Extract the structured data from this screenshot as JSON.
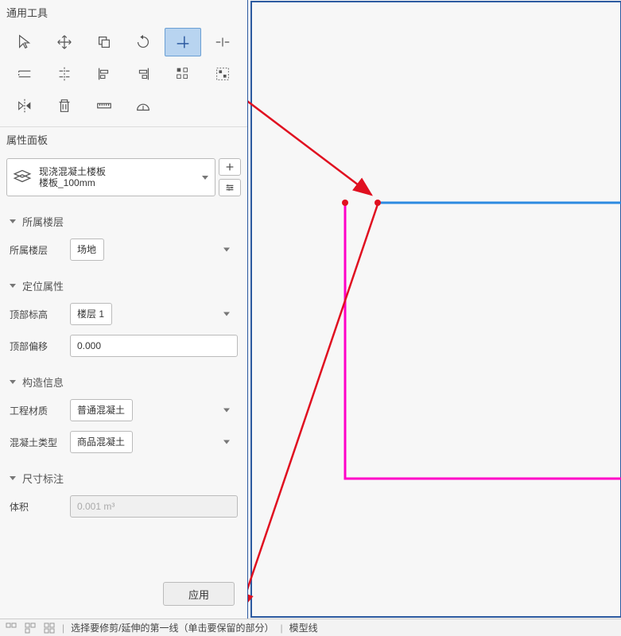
{
  "tools_panel": {
    "title": "通用工具"
  },
  "properties_panel": {
    "title": "属性面板",
    "type_selector": {
      "line1": "现浇混凝土楼板",
      "line2": "楼板_100mm"
    },
    "sections": {
      "floor": {
        "title": "所属楼层",
        "label": "所属楼层",
        "value": "场地"
      },
      "position": {
        "title": "定位属性",
        "top_elevation_label": "顶部标高",
        "top_elevation_value": "楼层 1",
        "top_offset_label": "顶部偏移",
        "top_offset_value": "0.000"
      },
      "construction": {
        "title": "构造信息",
        "material_label": "工程材质",
        "material_value": "普通混凝土",
        "concrete_type_label": "混凝土类型",
        "concrete_type_value": "商品混凝土"
      },
      "dimensions": {
        "title": "尺寸标注",
        "volume_label": "体积",
        "volume_value": "0.001 m³"
      }
    },
    "apply_label": "应用"
  },
  "status_bar": {
    "hint": "选择要修剪/延伸的第一线（单击要保留的部分）",
    "mode": "模型线",
    "separator": "|"
  }
}
